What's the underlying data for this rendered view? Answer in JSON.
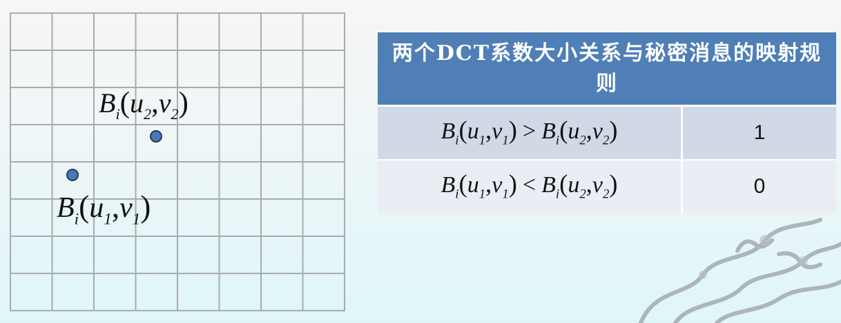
{
  "diagram": {
    "label_upper": {
      "B": "B",
      "i": "i",
      "open": "(",
      "u": "u",
      "u_sub": "2",
      "comma": ",",
      "v": "v",
      "v_sub": "2",
      "close": ")"
    },
    "label_lower": {
      "B": "B",
      "i": "i",
      "open": "(",
      "u": "u",
      "u_sub": "1",
      "comma": ",",
      "v": "v",
      "v_sub": "1",
      "close": ")"
    }
  },
  "table": {
    "header": "两个DCT系数大小关系与秘密消息的映射规则",
    "rows": [
      {
        "op": ">",
        "value": "1"
      },
      {
        "op": "<",
        "value": "0"
      }
    ]
  },
  "colors": {
    "header_bg": "#4f7fb6",
    "row1_bg": "#d1d8e6",
    "row2_bg": "#eaedf4",
    "dot": "#4a79b5"
  }
}
